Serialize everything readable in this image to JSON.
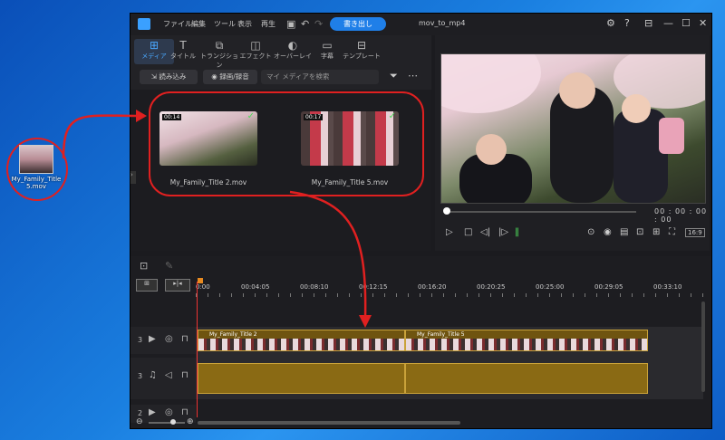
{
  "desktop": {
    "file_label": "My_Family_Title 5.mov"
  },
  "menu": [
    "ファイル",
    "編集",
    "ツール",
    "表示",
    "再生"
  ],
  "titlebar": {
    "export_label": "書き出し",
    "project_name": "mov_to_mp4"
  },
  "tabs": [
    {
      "label": "メディア",
      "icon": "media-icon"
    },
    {
      "label": "タイトル",
      "icon": "title-icon"
    },
    {
      "label": "トランジション",
      "icon": "transition-icon"
    },
    {
      "label": "エフェクト",
      "icon": "effect-icon"
    },
    {
      "label": "オーバーレイ",
      "icon": "overlay-icon"
    },
    {
      "label": "字幕",
      "icon": "subtitle-icon"
    },
    {
      "label": "テンプレート",
      "icon": "template-icon"
    }
  ],
  "media_toolbar": {
    "import_label": "読み込み",
    "record_label": "録画/録音",
    "search_placeholder": "マイ メディアを検索"
  },
  "library": [
    {
      "name": "My_Family_Title 2.mov",
      "duration": "00:14"
    },
    {
      "name": "My_Family_Title 5.mov",
      "duration": "00:17"
    }
  ],
  "preview": {
    "timecode": "00 : 00 : 00 : 00",
    "aspect": "16:9"
  },
  "timeline": {
    "ticks": [
      "0:00",
      "00:04:05",
      "00:08:10",
      "00:12:15",
      "00:16:20",
      "00:20:25",
      "00:25:00",
      "00:29:05",
      "00:33:10"
    ],
    "tracks": [
      "3",
      "3",
      "2"
    ],
    "clips": [
      "My_Family_Title 2",
      "My_Family_Title 5"
    ]
  },
  "colors": {
    "accent": "#1f7fe8",
    "annotation": "#e02020",
    "clip": "#8a6a14"
  }
}
